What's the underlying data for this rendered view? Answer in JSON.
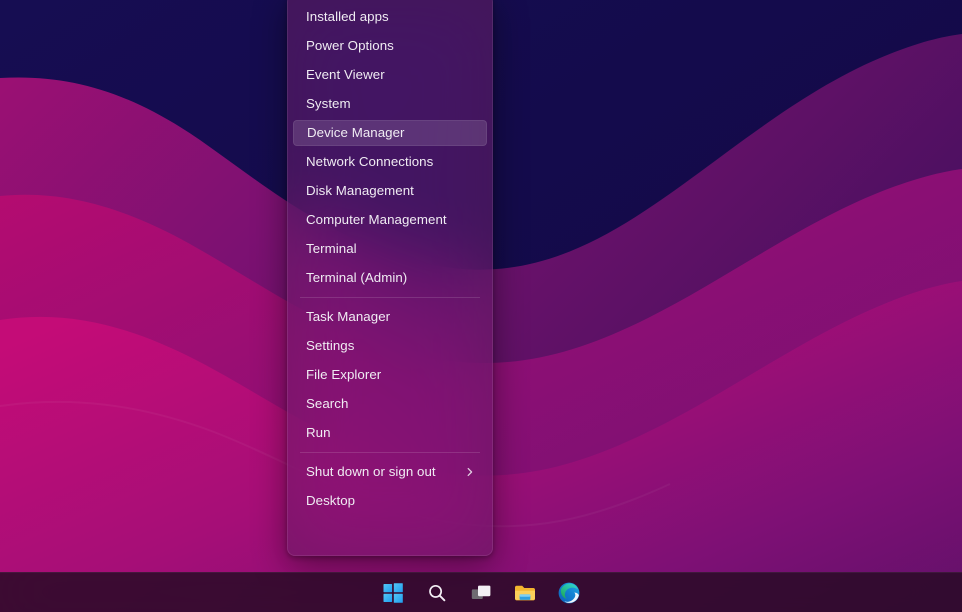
{
  "desktop": {
    "wallpaper_name": "abstract-wave-wallpaper",
    "colors": {
      "deep_navy": "#150c4e",
      "navy_mid": "#1b1159",
      "plum": "#6b1168",
      "magenta": "#b50d6e",
      "magenta_bright": "#c20d74",
      "purple_band": "#7a1176",
      "taskbar": "#2a0a26"
    }
  },
  "winx_menu": {
    "name": "Quick Link menu",
    "groups": [
      {
        "items": [
          {
            "label": "Installed apps",
            "highlighted": false,
            "submenu": false
          },
          {
            "label": "Power Options",
            "highlighted": false,
            "submenu": false
          },
          {
            "label": "Event Viewer",
            "highlighted": false,
            "submenu": false
          },
          {
            "label": "System",
            "highlighted": false,
            "submenu": false
          },
          {
            "label": "Device Manager",
            "highlighted": true,
            "submenu": false
          },
          {
            "label": "Network Connections",
            "highlighted": false,
            "submenu": false
          },
          {
            "label": "Disk Management",
            "highlighted": false,
            "submenu": false
          },
          {
            "label": "Computer Management",
            "highlighted": false,
            "submenu": false
          },
          {
            "label": "Terminal",
            "highlighted": false,
            "submenu": false
          },
          {
            "label": "Terminal (Admin)",
            "highlighted": false,
            "submenu": false
          }
        ]
      },
      {
        "items": [
          {
            "label": "Task Manager",
            "highlighted": false,
            "submenu": false
          },
          {
            "label": "Settings",
            "highlighted": false,
            "submenu": false
          },
          {
            "label": "File Explorer",
            "highlighted": false,
            "submenu": false
          },
          {
            "label": "Search",
            "highlighted": false,
            "submenu": false
          },
          {
            "label": "Run",
            "highlighted": false,
            "submenu": false
          }
        ]
      },
      {
        "items": [
          {
            "label": "Shut down or sign out",
            "highlighted": false,
            "submenu": true
          },
          {
            "label": "Desktop",
            "highlighted": false,
            "submenu": false
          }
        ]
      }
    ]
  },
  "taskbar": {
    "icons": [
      {
        "name": "start-icon",
        "title": "Start"
      },
      {
        "name": "search-icon",
        "title": "Search"
      },
      {
        "name": "task-view-icon",
        "title": "Task View"
      },
      {
        "name": "file-explorer-icon",
        "title": "File Explorer"
      },
      {
        "name": "microsoft-edge-icon",
        "title": "Microsoft Edge"
      }
    ]
  }
}
